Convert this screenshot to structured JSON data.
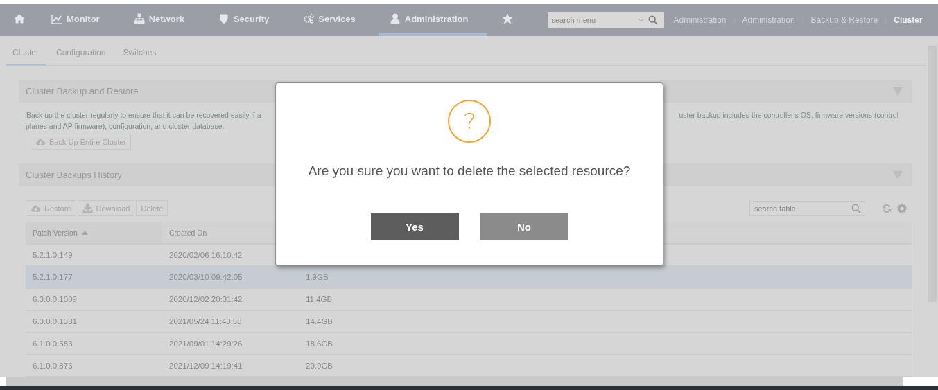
{
  "nav": {
    "items": [
      {
        "kind": "home",
        "selected": false
      },
      {
        "kind": "chart",
        "label": "Monitor",
        "selected": false
      },
      {
        "kind": "network",
        "label": "Network",
        "selected": false
      },
      {
        "kind": "shield",
        "label": "Security",
        "selected": false
      },
      {
        "kind": "gears",
        "label": "Services",
        "selected": false
      },
      {
        "kind": "user",
        "label": "Administration",
        "selected": true
      },
      {
        "kind": "star",
        "selected": false
      }
    ],
    "search": {
      "placeholder": "search menu"
    },
    "breadcrumbs": [
      {
        "label": "Administration",
        "current": false
      },
      {
        "label": "Administration",
        "current": false
      },
      {
        "label": "Backup & Restore",
        "current": false
      },
      {
        "label": "Cluster",
        "current": true
      }
    ]
  },
  "sub_tabs": [
    {
      "label": "Cluster",
      "selected": true
    },
    {
      "label": "Configuration",
      "selected": false
    },
    {
      "label": "Switches",
      "selected": false
    }
  ],
  "backup_restore": {
    "title": "Cluster Backup and Restore",
    "description_left": "Back up the cluster regularly to ensure that it can be recovered easily if a",
    "description_right": "uster backup includes the controller's OS, firmware versions (control",
    "description_line2": "planes and AP firmware), configuration, and cluster database.",
    "button": "Back Up Entire Cluster"
  },
  "history": {
    "title": "Cluster Backups History",
    "toolbar": [
      {
        "kind": "cloud-up",
        "label": "Restore"
      },
      {
        "kind": "download",
        "label": "Download"
      },
      {
        "kind": "plain",
        "label": "Delete"
      }
    ],
    "search": {
      "placeholder": "search table"
    },
    "table": {
      "columns": [
        {
          "label": "Patch Version",
          "sorted": true
        },
        {
          "label": "Created On",
          "sorted": false
        }
      ],
      "rows": [
        {
          "cells": [
            "5.2.1.0.149",
            "2020/02/06 16:10:42"
          ],
          "selected": false
        },
        {
          "cells": [
            "5.2.1.0.177",
            "2020/03/10 09:42:05",
            "1.9GB"
          ],
          "selected": true
        },
        {
          "cells": [
            "6.0.0.0.1009",
            "2020/12/02 20:31:42",
            "11.4GB"
          ],
          "selected": false
        },
        {
          "cells": [
            "6.0.0.0.1331",
            "2021/05/24 11:43:58",
            "14.4GB"
          ],
          "selected": false
        },
        {
          "cells": [
            "6.1.0.0.583",
            "2021/09/01 14:29:26",
            "18.6GB"
          ],
          "selected": false
        },
        {
          "cells": [
            "6.1.0.0.875",
            "2021/12/09 14:19:41",
            "20.9GB"
          ],
          "selected": false
        }
      ]
    }
  },
  "dialog": {
    "message": "Are you sure you want to delete the selected resource?",
    "buttons": [
      {
        "label": "Yes",
        "kind": "primary"
      },
      {
        "label": "No",
        "kind": "secondary"
      }
    ]
  }
}
